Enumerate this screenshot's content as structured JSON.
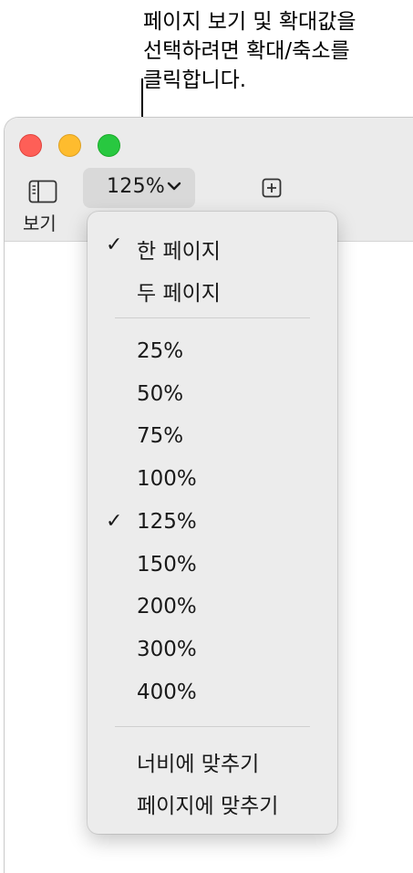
{
  "callout": {
    "line1": "페이지 보기 및 확대값을",
    "line2": "선택하려면 확대/축소를",
    "line3": "클릭합니다."
  },
  "toolbar": {
    "view_label": "보기",
    "zoom_value": "125%"
  },
  "menu": {
    "items": [
      {
        "label": "한 페이지",
        "checked": true
      },
      {
        "label": "두 페이지",
        "checked": false
      },
      {
        "label": "25%",
        "checked": false
      },
      {
        "label": "50%",
        "checked": false
      },
      {
        "label": "75%",
        "checked": false
      },
      {
        "label": "100%",
        "checked": false
      },
      {
        "label": "125%",
        "checked": true
      },
      {
        "label": "150%",
        "checked": false
      },
      {
        "label": "200%",
        "checked": false
      },
      {
        "label": "300%",
        "checked": false
      },
      {
        "label": "400%",
        "checked": false
      },
      {
        "label": "너비에 맞추기",
        "checked": false
      },
      {
        "label": "페이지에 맞추기",
        "checked": false
      }
    ],
    "check_glyph": "✓"
  },
  "icons": {
    "view": "sidebar-view-icon",
    "zoom_chevron": "chevron-down-icon",
    "add_page": "add-page-icon"
  },
  "colors": {
    "close": "#fe5f57",
    "minimize": "#febc2e",
    "zoom": "#28c840",
    "menu_bg": "#ececec",
    "toolbar_bg": "#ebebeb"
  }
}
